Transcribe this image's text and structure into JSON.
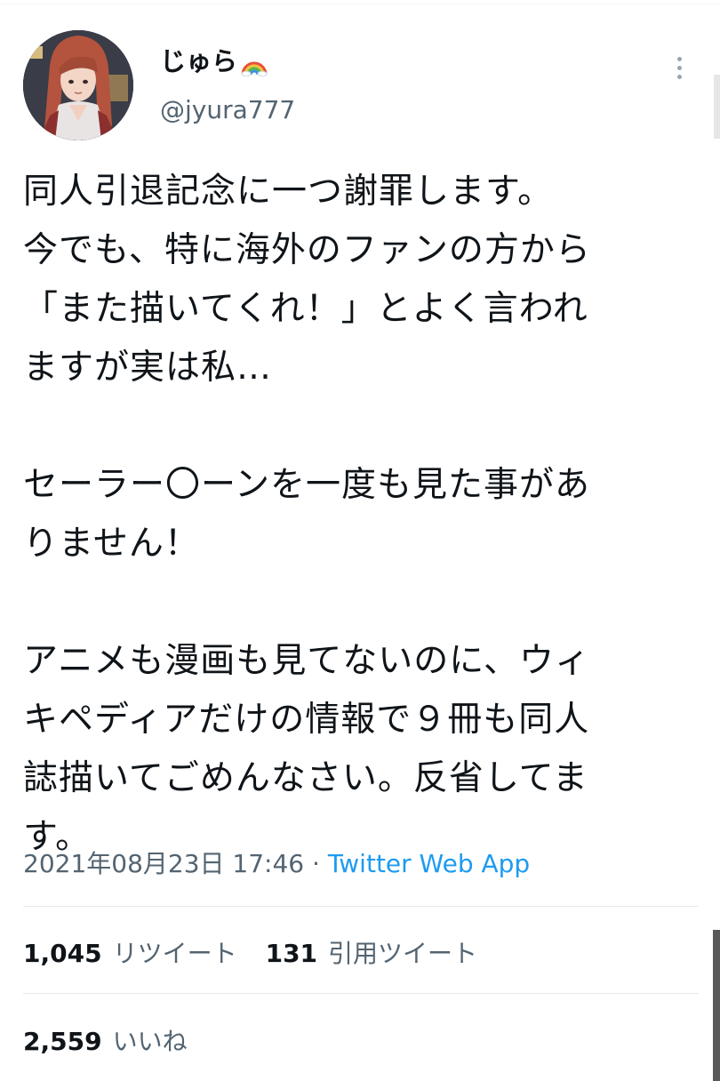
{
  "author": {
    "display_name": "じゅら",
    "handle": "@jyura777"
  },
  "tweet": {
    "text": "同人引退記念に一つ謝罪します。\n今でも、特に海外のファンの方から\n「また描いてくれ！」とよく言われ\nますが実は私…\n\nセーラー〇ーンを一度も見た事があ\nりません！\n\nアニメも漫画も見てないのに、ウィ\nキペディアだけの情報で９冊も同人\n誌描いてごめんなさい。反省してま\nす。",
    "timestamp": "2021年08月23日 17:46",
    "separator": " · ",
    "source": "Twitter Web App"
  },
  "stats": {
    "retweets": {
      "count": "1,045",
      "label": "リツイート"
    },
    "quotes": {
      "count": "131",
      "label": "引用ツイート"
    },
    "likes": {
      "count": "2,559",
      "label": "いいね"
    }
  },
  "colors": {
    "text": "#0f1419",
    "secondary": "#536471",
    "link": "#1d9bf0",
    "divider": "#e4e9ec"
  },
  "icons": {
    "display_name_emoji": "rainbow-icon",
    "more": "more-vertical-icon"
  }
}
